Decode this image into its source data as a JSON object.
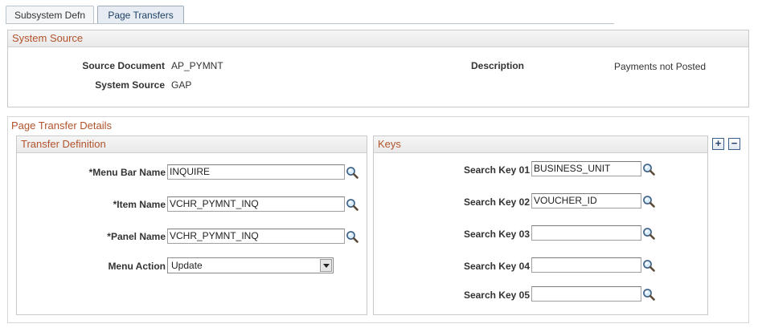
{
  "tabs": [
    {
      "label": "Subsystem Defn",
      "active": false
    },
    {
      "label": "Page Transfers",
      "active": true
    }
  ],
  "system_source": {
    "title": "System Source",
    "source_document_label": "Source Document",
    "source_document_value": "AP_PYMNT",
    "system_source_label": "System Source",
    "system_source_value": "GAP",
    "description_label": "Description",
    "description_value": "Payments not Posted"
  },
  "page_transfer_details": {
    "title": "Page Transfer Details",
    "add_symbol": "+",
    "remove_symbol": "−",
    "transfer_definition": {
      "title": "Transfer Definition",
      "menu_bar_name_label": "*Menu Bar Name",
      "menu_bar_name_value": "INQUIRE",
      "item_name_label": "*Item Name",
      "item_name_value": "VCHR_PYMNT_INQ",
      "panel_name_label": "*Panel Name",
      "panel_name_value": "VCHR_PYMNT_INQ",
      "menu_action_label": "Menu Action",
      "menu_action_value": "Update"
    },
    "keys": {
      "title": "Keys",
      "items": [
        {
          "label": "Search Key 01",
          "value": "BUSINESS_UNIT"
        },
        {
          "label": "Search Key 02",
          "value": "VOUCHER_ID"
        },
        {
          "label": "Search Key 03",
          "value": ""
        },
        {
          "label": "Search Key 04",
          "value": ""
        },
        {
          "label": "Search Key 05",
          "value": ""
        }
      ]
    }
  },
  "icons": {
    "lookup": "magnifier-lookup-icon",
    "add": "add-row-icon",
    "remove": "delete-row-icon"
  }
}
